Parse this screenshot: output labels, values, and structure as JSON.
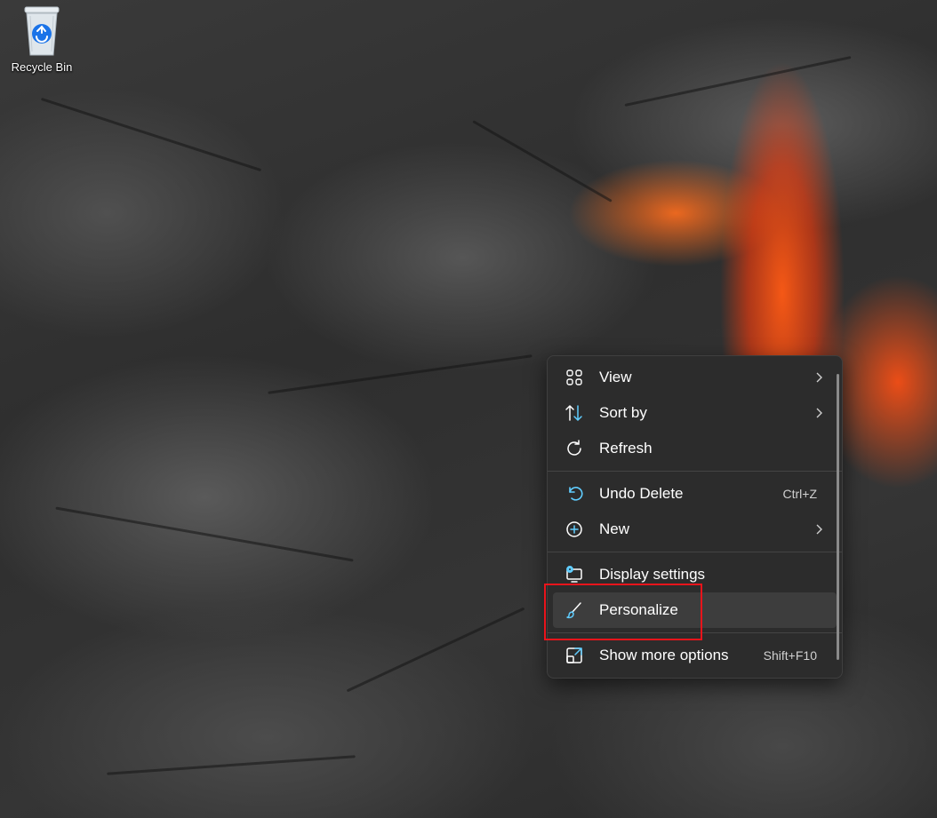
{
  "desktop": {
    "icons": [
      {
        "label": "Recycle Bin",
        "icon": "recycle-bin-icon"
      }
    ]
  },
  "context_menu": {
    "groups": [
      [
        {
          "label": "View",
          "icon": "grid-icon",
          "has_submenu": true
        },
        {
          "label": "Sort by",
          "icon": "sort-icon",
          "has_submenu": true
        },
        {
          "label": "Refresh",
          "icon": "refresh-icon",
          "has_submenu": false
        }
      ],
      [
        {
          "label": "Undo Delete",
          "icon": "undo-icon",
          "shortcut": "Ctrl+Z"
        },
        {
          "label": "New",
          "icon": "plus-circle-icon",
          "has_submenu": true
        }
      ],
      [
        {
          "label": "Display settings",
          "icon": "display-settings-icon"
        },
        {
          "label": "Personalize",
          "icon": "brush-icon",
          "hovered": true
        }
      ],
      [
        {
          "label": "Show more options",
          "icon": "show-more-icon",
          "shortcut": "Shift+F10"
        }
      ]
    ],
    "accent_color": "#60cdff",
    "highlight_color": "#e8141b"
  }
}
